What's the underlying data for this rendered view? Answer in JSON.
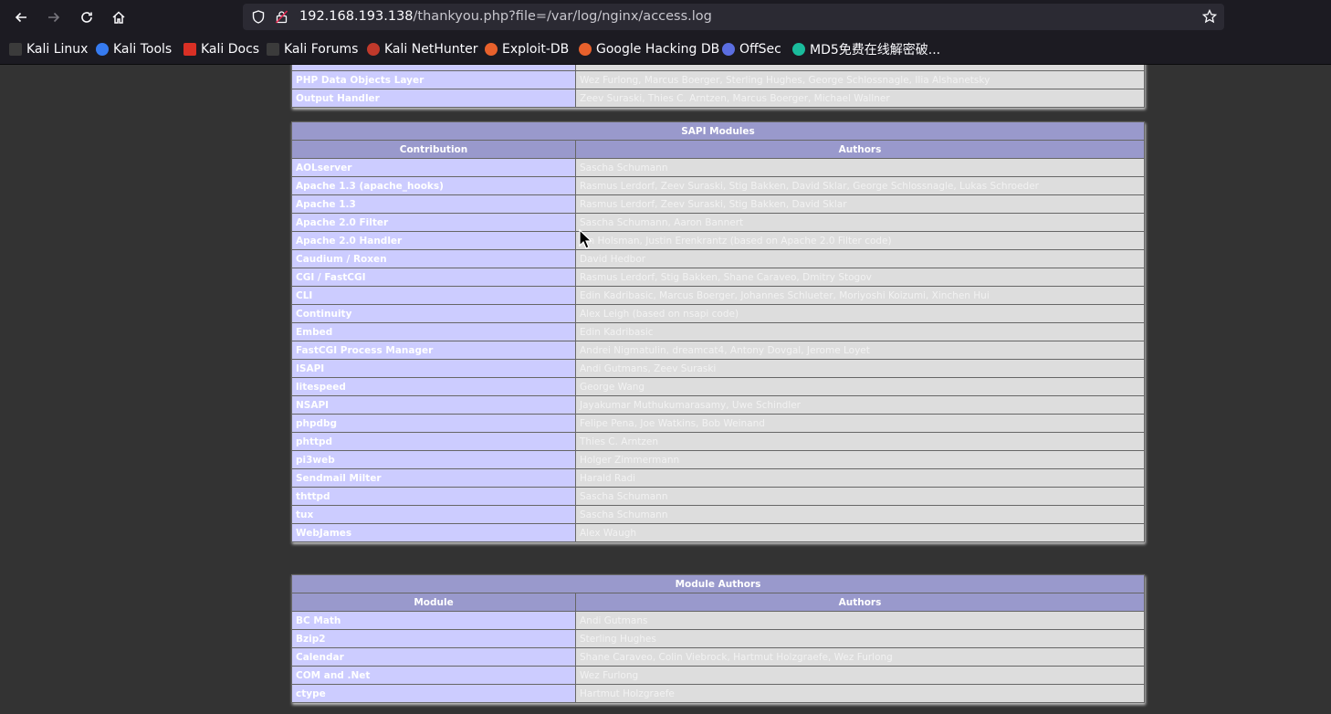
{
  "browser": {
    "url_host": "192.168.193.138",
    "url_path": "/thankyou.php?file=/var/log/nginx/access.log",
    "bookmarks": [
      "Kali Linux",
      "Kali Tools",
      "Kali Docs",
      "Kali Forums",
      "Kali NetHunter",
      "Exploit-DB",
      "Google Hacking DB",
      "OffSec",
      "MD5免费在线解密破..."
    ]
  },
  "top_table": {
    "rows": [
      {
        "name": "PHP Data Objects Layer",
        "authors": "Wez Furlong, Marcus Boerger, Sterling Hughes, George Schlossnagle, Ilia Alshanetsky"
      },
      {
        "name": "Output Handler",
        "authors": "Zeev Suraski, Thies C. Arntzen, Marcus Boerger, Michael Wallner"
      }
    ]
  },
  "sapi_table": {
    "title": "SAPI Modules",
    "col1": "Contribution",
    "col2": "Authors",
    "rows": [
      {
        "name": "AOLserver",
        "authors": "Sascha Schumann"
      },
      {
        "name": "Apache 1.3 (apache_hooks)",
        "authors": "Rasmus Lerdorf, Zeev Suraski, Stig Bakken, David Sklar, George Schlossnagle, Lukas Schroeder"
      },
      {
        "name": "Apache 1.3",
        "authors": "Rasmus Lerdorf, Zeev Suraski, Stig Bakken, David Sklar"
      },
      {
        "name": "Apache 2.0 Filter",
        "authors": "Sascha Schumann, Aaron Bannert"
      },
      {
        "name": "Apache 2.0 Handler",
        "authors": "Ian Holsman, Justin Erenkrantz (based on Apache 2.0 Filter code)"
      },
      {
        "name": "Caudium / Roxen",
        "authors": "David Hedbor"
      },
      {
        "name": "CGI / FastCGI",
        "authors": "Rasmus Lerdorf, Stig Bakken, Shane Caraveo, Dmitry Stogov"
      },
      {
        "name": "CLI",
        "authors": "Edin Kadribasic, Marcus Boerger, Johannes Schlueter, Moriyoshi Koizumi, Xinchen Hui"
      },
      {
        "name": "Continuity",
        "authors": "Alex Leigh (based on nsapi code)"
      },
      {
        "name": "Embed",
        "authors": "Edin Kadribasic"
      },
      {
        "name": "FastCGI Process Manager",
        "authors": "Andrei Nigmatulin, dreamcat4, Antony Dovgal, Jerome Loyet"
      },
      {
        "name": "ISAPI",
        "authors": "Andi Gutmans, Zeev Suraski"
      },
      {
        "name": "litespeed",
        "authors": "George Wang"
      },
      {
        "name": "NSAPI",
        "authors": "Jayakumar Muthukumarasamy, Uwe Schindler"
      },
      {
        "name": "phpdbg",
        "authors": "Felipe Pena, Joe Watkins, Bob Weinand"
      },
      {
        "name": "phttpd",
        "authors": "Thies C. Arntzen"
      },
      {
        "name": "pi3web",
        "authors": "Holger Zimmermann"
      },
      {
        "name": "Sendmail Milter",
        "authors": "Harald Radi"
      },
      {
        "name": "thttpd",
        "authors": "Sascha Schumann"
      },
      {
        "name": "tux",
        "authors": "Sascha Schumann"
      },
      {
        "name": "WebJames",
        "authors": "Alex Waugh"
      }
    ]
  },
  "module_table": {
    "title": "Module Authors",
    "col1": "Module",
    "col2": "Authors",
    "rows": [
      {
        "name": "BC Math",
        "authors": "Andi Gutmans"
      },
      {
        "name": "Bzip2",
        "authors": "Sterling Hughes"
      },
      {
        "name": "Calendar",
        "authors": "Shane Caraveo, Colin Viebrock, Hartmut Holzgraefe, Wez Furlong"
      },
      {
        "name": "COM and .Net",
        "authors": "Wez Furlong"
      },
      {
        "name": "ctype",
        "authors": "Hartmut Holzgraefe"
      }
    ]
  }
}
